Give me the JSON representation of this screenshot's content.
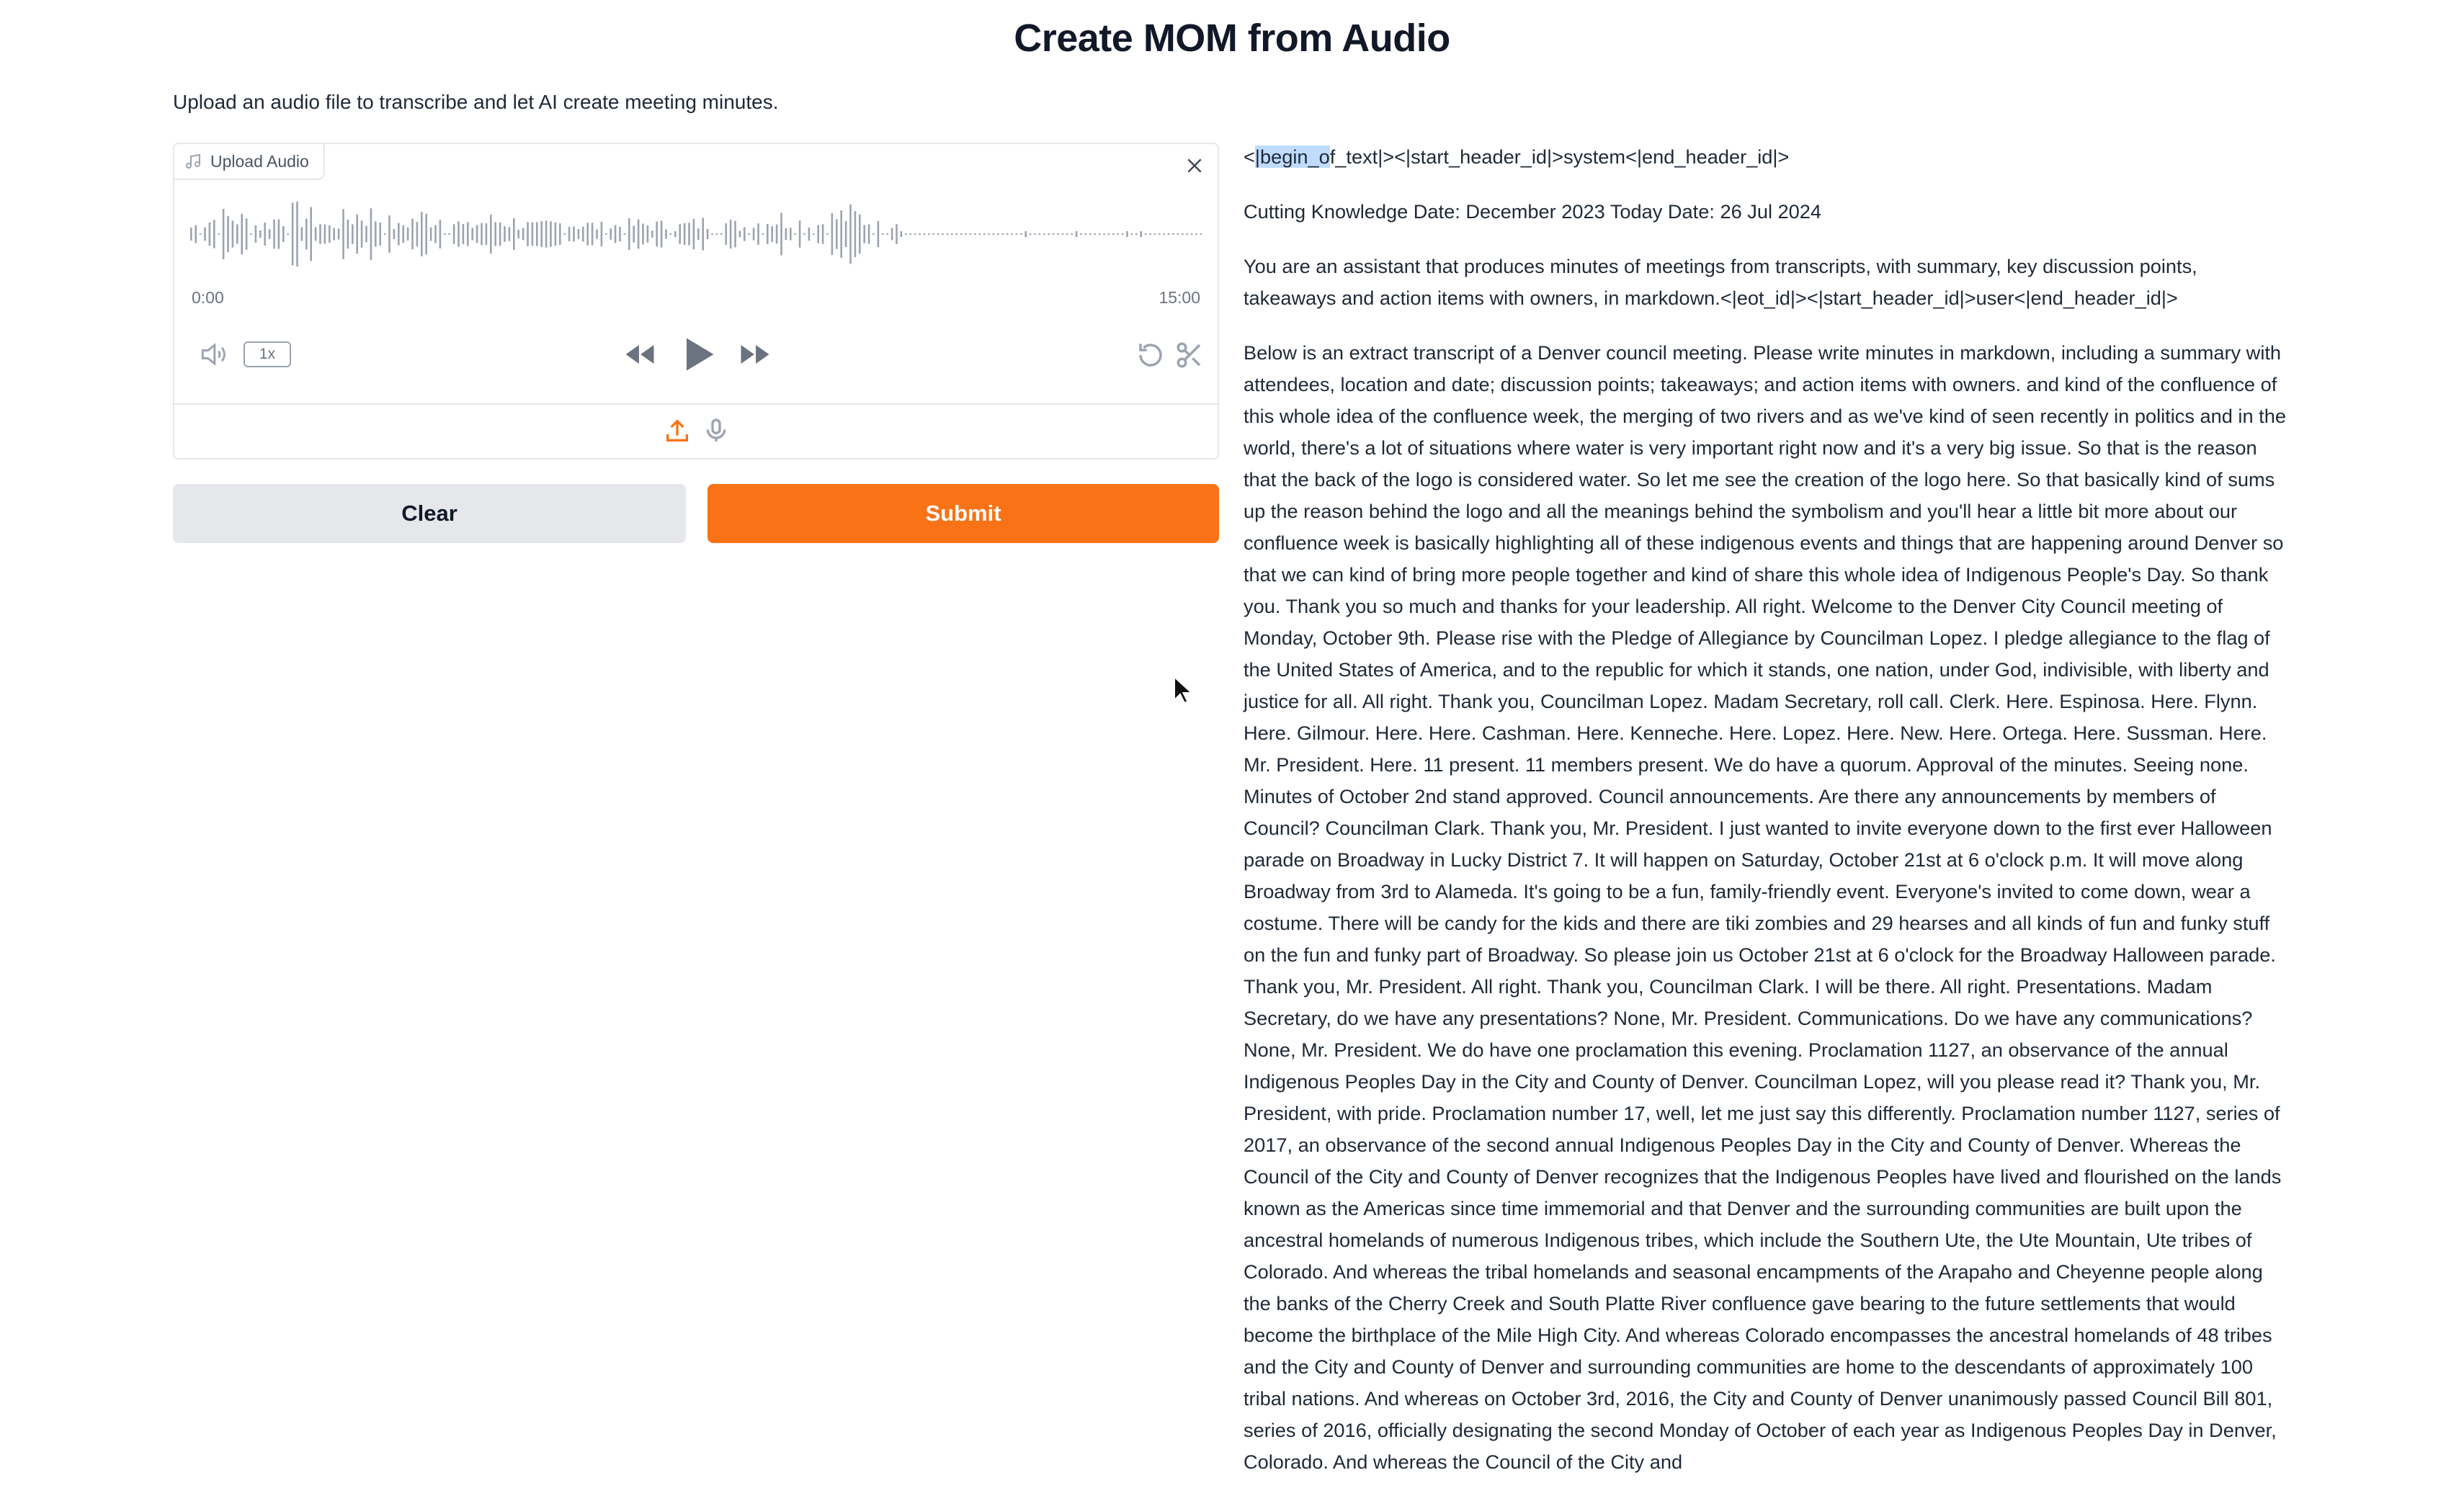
{
  "page": {
    "title": "Create MOM from Audio",
    "description": "Upload an audio file to transcribe and let AI create meeting minutes."
  },
  "audio": {
    "upload_label": "Upload Audio",
    "time_current": "0:00",
    "time_total": "15:00",
    "speed": "1x",
    "icons": [
      "music-icon",
      "close-icon",
      "volume-icon",
      "rewind-icon",
      "play-icon",
      "fast-forward-icon",
      "undo-icon",
      "scissors-icon",
      "upload-icon",
      "microphone-icon"
    ]
  },
  "buttons": {
    "clear": "Clear",
    "submit": "Submit"
  },
  "colors": {
    "accent": "#f97316",
    "secondary_button": "#e5e7eb",
    "selection": "#bfdbfe"
  },
  "output": {
    "line1_lead": "<",
    "line1_selected": "|begin_o",
    "line1_rest": "f_text|><|start_header_id|>system<|end_header_id|>",
    "p2": "Cutting Knowledge Date: December 2023 Today Date: 26 Jul 2024",
    "p3": "You are an assistant that produces minutes of meetings from transcripts, with summary, key discussion points, takeaways and action items with owners, in markdown.<|eot_id|><|start_header_id|>user<|end_header_id|>",
    "p4": "Below is an extract transcript of a Denver council meeting. Please write minutes in markdown, including a summary with attendees, location and date; discussion points; takeaways; and action items with owners. and kind of the confluence of this whole idea of the confluence week, the merging of two rivers and as we've kind of seen recently in politics and in the world, there's a lot of situations where water is very important right now and it's a very big issue. So that is the reason that the back of the logo is considered water. So let me see the creation of the logo here. So that basically kind of sums up the reason behind the logo and all the meanings behind the symbolism and you'll hear a little bit more about our confluence week is basically highlighting all of these indigenous events and things that are happening around Denver so that we can kind of bring more people together and kind of share this whole idea of Indigenous People's Day. So thank you. Thank you so much and thanks for your leadership. All right. Welcome to the Denver City Council meeting of Monday, October 9th. Please rise with the Pledge of Allegiance by Councilman Lopez. I pledge allegiance to the flag of the United States of America, and to the republic for which it stands, one nation, under God, indivisible, with liberty and justice for all. All right. Thank you, Councilman Lopez. Madam Secretary, roll call. Clerk. Here. Espinosa. Here. Flynn. Here. Gilmour. Here. Here. Cashman. Here. Kenneche. Here. Lopez. Here. New. Here. Ortega. Here. Sussman. Here. Mr. President. Here. 11 present. 11 members present. We do have a quorum. Approval of the minutes. Seeing none. Minutes of October 2nd stand approved. Council announcements. Are there any announcements by members of Council? Councilman Clark. Thank you, Mr. President. I just wanted to invite everyone down to the first ever Halloween parade on Broadway in Lucky District 7. It will happen on Saturday, October 21st at 6 o'clock p.m. It will move along Broadway from 3rd to Alameda. It's going to be a fun, family-friendly event. Everyone's invited to come down, wear a costume. There will be candy for the kids and there are tiki zombies and 29 hearses and all kinds of fun and funky stuff on the fun and funky part of Broadway. So please join us October 21st at 6 o'clock for the Broadway Halloween parade. Thank you, Mr. President. All right. Thank you, Councilman Clark. I will be there. All right. Presentations. Madam Secretary, do we have any presentations? None, Mr. President. Communications. Do we have any communications? None, Mr. President. We do have one proclamation this evening. Proclamation 1127, an observance of the annual Indigenous Peoples Day in the City and County of Denver. Councilman Lopez, will you please read it? Thank you, Mr. President, with pride. Proclamation number 17, well, let me just say this differently. Proclamation number 1127, series of 2017, an observance of the second annual Indigenous Peoples Day in the City and County of Denver. Whereas the Council of the City and County of Denver recognizes that the Indigenous Peoples have lived and flourished on the lands known as the Americas since time immemorial and that Denver and the surrounding communities are built upon the ancestral homelands of numerous Indigenous tribes, which include the Southern Ute, the Ute Mountain, Ute tribes of Colorado. And whereas the tribal homelands and seasonal encampments of the Arapaho and Cheyenne people along the banks of the Cherry Creek and South Platte River confluence gave bearing to the future settlements that would become the birthplace of the Mile High City. And whereas Colorado encompasses the ancestral homelands of 48 tribes and the City and County of Denver and surrounding communities are home to the descendants of approximately 100 tribal nations. And whereas on October 3rd, 2016, the City and County of Denver unanimously passed Council Bill 801, series of 2016, officially designating the second Monday of October of each year as Indigenous Peoples Day in Denver, Colorado. And whereas the Council of the City and"
  }
}
